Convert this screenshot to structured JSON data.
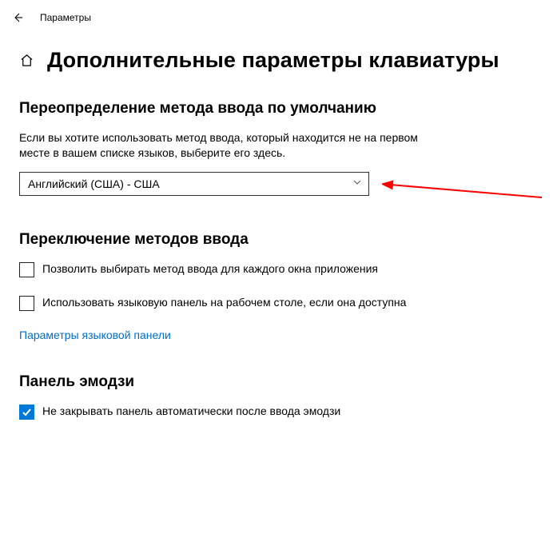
{
  "window": {
    "title": "Параметры"
  },
  "page": {
    "title": "Дополнительные параметры клавиатуры"
  },
  "override": {
    "heading": "Переопределение метода ввода по умолчанию",
    "desc": "Если вы хотите использовать метод ввода, который находится не на первом месте в вашем списке языков, выберите его здесь.",
    "selected": "Английский (США) - США"
  },
  "switching": {
    "heading": "Переключение методов ввода",
    "per_window": "Позволить выбирать метод ввода для каждого окна приложения",
    "lang_bar": "Использовать языковую панель на рабочем столе, если она доступна",
    "link": "Параметры языковой панели"
  },
  "emoji": {
    "heading": "Панель эмодзи",
    "no_close": "Не закрывать панель автоматически после ввода эмодзи"
  }
}
